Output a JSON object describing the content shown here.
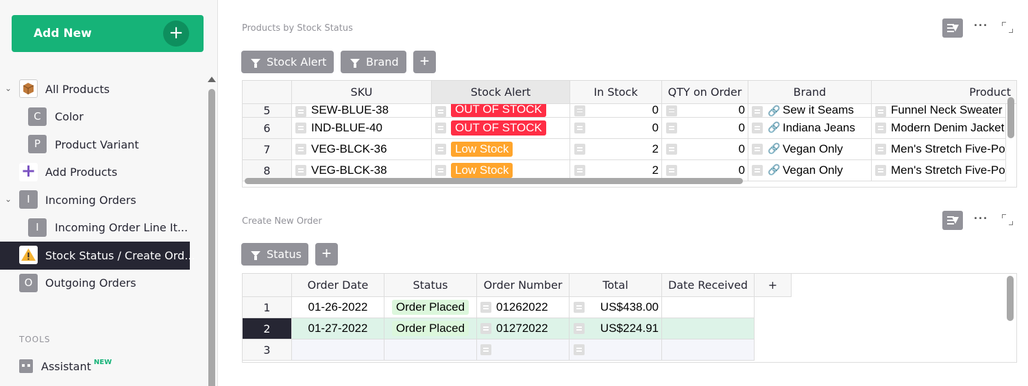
{
  "sidebar": {
    "add_new": "Add New",
    "pages": [
      {
        "label": "All Products",
        "icon": "box-icon"
      },
      {
        "label": "Color",
        "icon_letter": "C"
      },
      {
        "label": "Product Variant",
        "icon_letter": "P"
      },
      {
        "label": "Add Products",
        "icon": "plus-icon"
      },
      {
        "label": "Incoming Orders",
        "icon_letter": "I"
      },
      {
        "label": "Incoming Order Line It...",
        "icon_letter": "I"
      },
      {
        "label": "Stock Status / Create Ord...",
        "icon": "warning-icon"
      },
      {
        "label": "Outgoing Orders",
        "icon_letter": "O"
      }
    ],
    "tools_header": "TOOLS",
    "assistant": "Assistant",
    "assistant_badge": "NEW"
  },
  "widget1": {
    "title": "Products by Stock Status",
    "filters": [
      "Stock Alert",
      "Brand"
    ],
    "columns": [
      "SKU",
      "Stock Alert",
      "In Stock",
      "QTY on Order",
      "Brand",
      "Product"
    ],
    "rows": [
      {
        "n": "5",
        "sku": "SEW-BLUE-38",
        "alert": "OUT OF STOCK",
        "alert_color": "#ff2e45",
        "in_stock": "0",
        "qty": "0",
        "brand": "Sew it Seams",
        "product": "Funnel Neck Sweater"
      },
      {
        "n": "6",
        "sku": "IND-BLUE-40",
        "alert": "OUT OF STOCK",
        "alert_color": "#ff2e45",
        "in_stock": "0",
        "qty": "0",
        "brand": "Indiana Jeans",
        "product": "Modern Denim Jacket"
      },
      {
        "n": "7",
        "sku": "VEG-BLCK-36",
        "alert": "Low Stock",
        "alert_color": "#ffa52c",
        "in_stock": "2",
        "qty": "0",
        "brand": "Vegan Only",
        "product": "Men's Stretch Five-Pocket"
      },
      {
        "n": "8",
        "sku": "VEG-BLCK-38",
        "alert": "Low Stock",
        "alert_color": "#ffa52c",
        "in_stock": "2",
        "qty": "0",
        "brand": "Vegan Only",
        "product": "Men's Stretch Five-Pocket"
      }
    ]
  },
  "widget2": {
    "title": "Create New Order",
    "filters": [
      "Status"
    ],
    "columns": [
      "Order Date",
      "Status",
      "Order Number",
      "Total",
      "Date Received",
      "+"
    ],
    "rows": [
      {
        "n": "1",
        "date": "01-26-2022",
        "status": "Order Placed",
        "number": "01262022",
        "total": "US$438.00",
        "received": ""
      },
      {
        "n": "2",
        "date": "01-27-2022",
        "status": "Order Placed",
        "number": "01272022",
        "total": "US$224.91",
        "received": ""
      },
      {
        "n": "3",
        "date": "",
        "status": "",
        "number": "",
        "total": "",
        "received": ""
      }
    ]
  },
  "colors": {
    "accent": "#16b378",
    "out_of_stock": "#ff2e45",
    "low_stock": "#ffa52c",
    "order_placed_bg": "#dcf7dc"
  }
}
